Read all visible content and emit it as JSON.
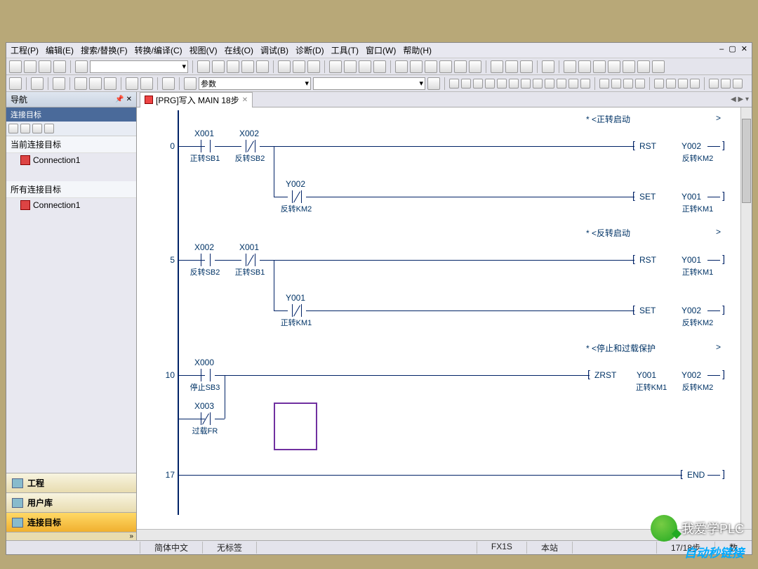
{
  "menu": {
    "project": "工程(P)",
    "edit": "编辑(E)",
    "search": "搜索/替换(F)",
    "convert": "转换/编译(C)",
    "view": "视图(V)",
    "online": "在线(O)",
    "debug": "调试(B)",
    "diagnose": "诊断(D)",
    "tools": "工具(T)",
    "window": "窗口(W)",
    "help": "帮助(H)"
  },
  "toolbar": {
    "param_dropdown": "参数"
  },
  "nav": {
    "title": "导航",
    "subtitle": "连接目标",
    "current": "当前连接目标",
    "all": "所有连接目标",
    "conn": "Connection1",
    "btn_project": "工程",
    "btn_userlib": "用户库",
    "btn_conn": "连接目标"
  },
  "tab": {
    "title": "[PRG]写入 MAIN 18步"
  },
  "ladder": {
    "comments": {
      "fwd_start": "* <正转启动",
      "rev_start": "* <反转启动",
      "stop_protect": "* <停止和过载保护"
    },
    "r0": {
      "num": "0",
      "x001": "X001",
      "x001_d": "正转SB1",
      "x002": "X002",
      "x002_d": "反转SB2",
      "y002": "Y002",
      "y002_d": "反转KM2",
      "rst": "RST",
      "out_rst": "Y002",
      "out_rst_d": "反转KM2",
      "set": "SET",
      "out_set": "Y001",
      "out_set_d": "正转KM1"
    },
    "r5": {
      "num": "5",
      "x002": "X002",
      "x002_d": "反转SB2",
      "x001": "X001",
      "x001_d": "正转SB1",
      "y001": "Y001",
      "y001_d": "正转KM1",
      "rst": "RST",
      "out_rst": "Y001",
      "out_rst_d": "正转KM1",
      "set": "SET",
      "out_set": "Y002",
      "out_set_d": "反转KM2"
    },
    "r10": {
      "num": "10",
      "x000": "X000",
      "x000_d": "停止SB3",
      "x003": "X003",
      "x003_d": "过载FR",
      "zrst": "ZRST",
      "out1": "Y001",
      "out1_d": "正转KM1",
      "out2": "Y002",
      "out2_d": "反转KM2"
    },
    "r17": {
      "num": "17",
      "end": "END"
    }
  },
  "status": {
    "lang": "简体中文",
    "label": "无标签",
    "plc": "FX1S",
    "station": "本站",
    "step": "17/18步",
    "extra": "数"
  },
  "watermark": {
    "line1": "我爱学PLC",
    "line2": "自动秒链接"
  }
}
